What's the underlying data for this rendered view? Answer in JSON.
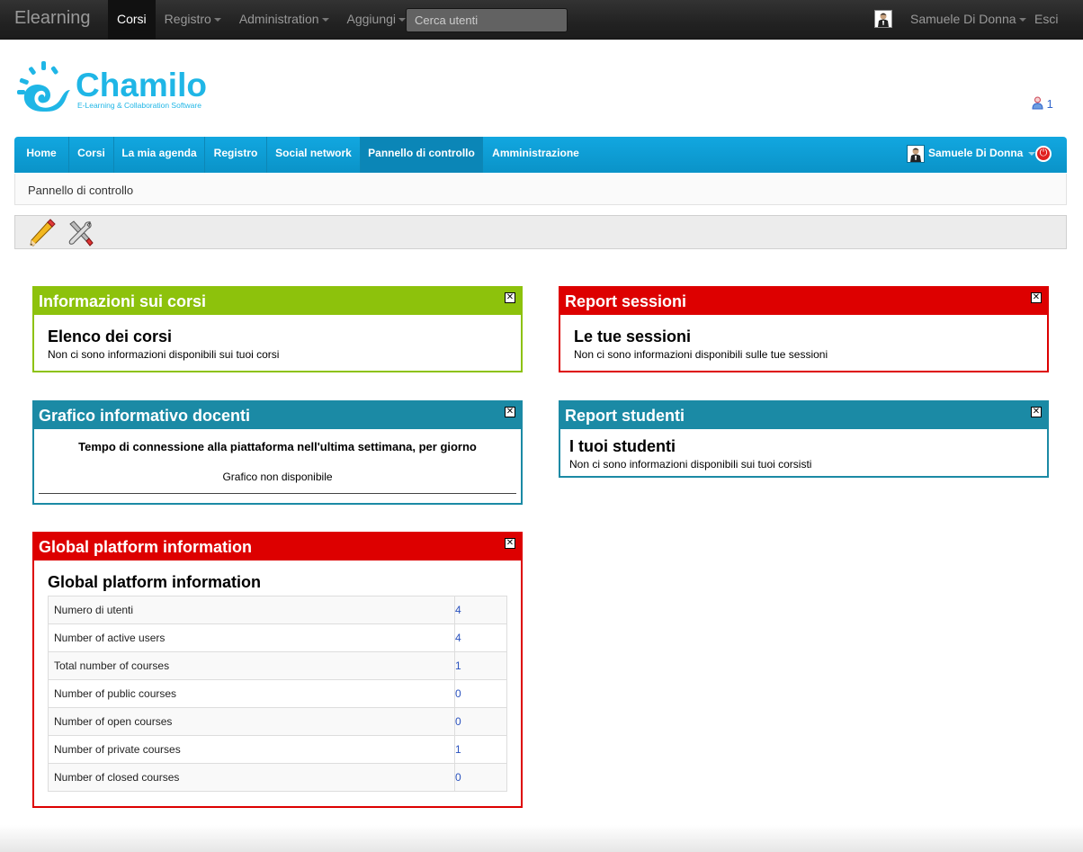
{
  "topbar": {
    "brand": "Elearning",
    "menu": [
      "Corsi",
      "Registro",
      "Administration",
      "Aggiungi"
    ],
    "search_placeholder": "Cerca utenti",
    "user": "Samuele Di Donna",
    "logout": "Esci"
  },
  "logo": {
    "word": "Chamilo",
    "tagline": "E-Learning & Collaboration Software"
  },
  "online_count": "1",
  "mainnav": {
    "items": [
      "Home",
      "Corsi",
      "La mia agenda",
      "Registro",
      "Social network",
      "Pannello di controllo",
      "Amministrazione"
    ],
    "active": "Pannello di controllo",
    "user": "Samuele Di Donna"
  },
  "breadcrumb": "Pannello di controllo",
  "blocks": {
    "courses": {
      "header": "Informazioni sui corsi",
      "title": "Elenco dei corsi",
      "message": "Non ci sono informazioni disponibili sui tuoi corsi",
      "color": "#8dc20c"
    },
    "sessions": {
      "header": "Report sessioni",
      "title": "Le tue sessioni",
      "message": "Non ci sono informazioni disponibili sulle tue sessioni",
      "color": "#dd0000"
    },
    "teachers": {
      "header": "Grafico informativo docenti",
      "chart_title": "Tempo di connessione alla piattaforma nell'ultima settimana, per giorno",
      "chart_message": "Grafico non disponibile",
      "color": "#1b8aa5"
    },
    "students": {
      "header": "Report studenti",
      "title": "I tuoi studenti",
      "message": "Non ci sono informazioni disponibili sui tuoi corsisti",
      "color": "#1b8aa5"
    },
    "global": {
      "header": "Global platform information",
      "title": "Global platform information",
      "color": "#dd0000",
      "rows": [
        {
          "label": "Numero di utenti",
          "value": "4"
        },
        {
          "label": "Number of active users",
          "value": "4"
        },
        {
          "label": "Total number of courses",
          "value": "1"
        },
        {
          "label": "Number of public courses",
          "value": "0"
        },
        {
          "label": "Number of open courses",
          "value": "0"
        },
        {
          "label": "Number of private courses",
          "value": "1"
        },
        {
          "label": "Number of closed courses",
          "value": "0"
        }
      ]
    }
  },
  "icons": {
    "edit": "pencil-icon",
    "settings": "tools-icon",
    "close": "close-icon",
    "logout": "power-icon"
  }
}
